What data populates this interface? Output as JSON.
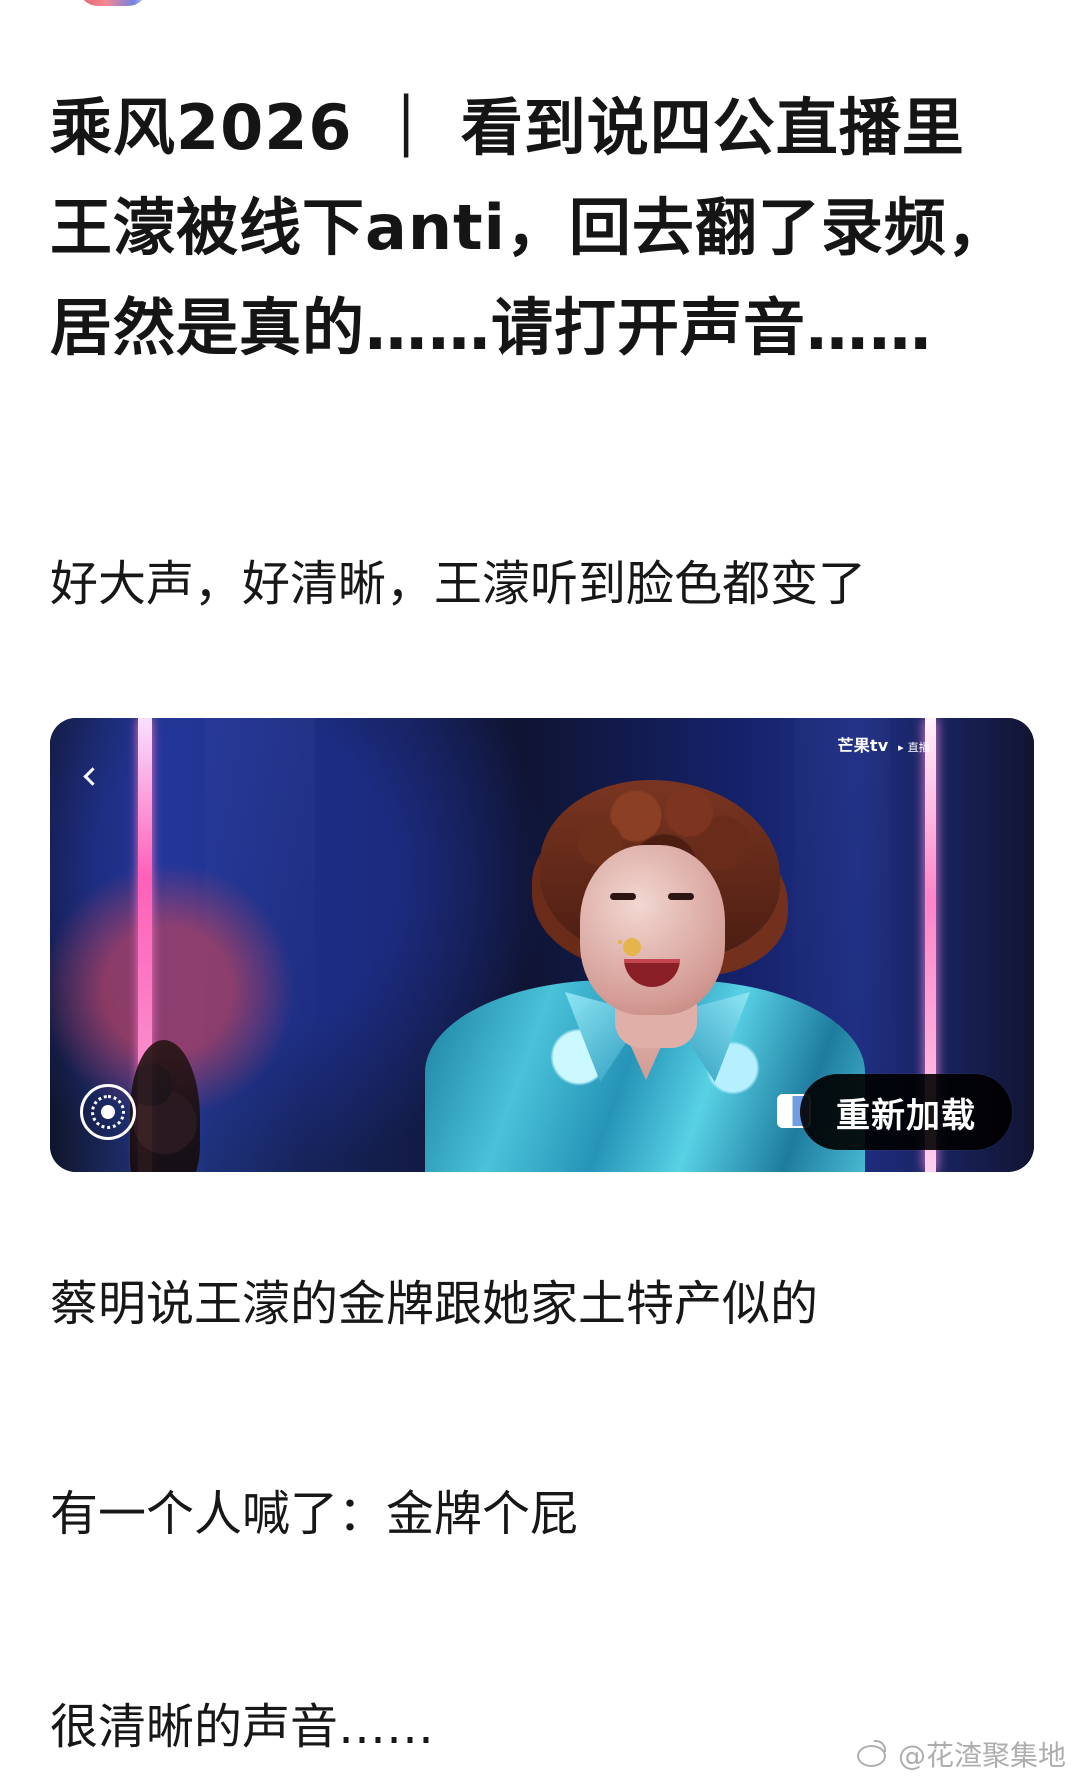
{
  "post": {
    "title": "乘风2026 ｜ 看到说四公直播里王濛被线下anti，回去翻了录频，居然是真的……请打开声音……",
    "paragraphs": [
      "好大声，好清晰，王濛听到脸色都变了",
      "蔡明说王濛的金牌跟她家土特产似的",
      "有一个人喊了：金牌个屁",
      "很清晰的声音……"
    ]
  },
  "video": {
    "brand": "芒果tv",
    "brand_sub": "▸ 直播",
    "reload_label": "重新加载"
  },
  "watermark": {
    "text": "@花渣聚集地"
  },
  "icons": {
    "back": "chevron-left-icon",
    "target": "target-icon",
    "weibo": "weibo-icon"
  },
  "colors": {
    "background": "#ffffff",
    "text": "#111111",
    "reload_button": "#000000",
    "video_pink": "#ff6fbe",
    "video_blue": "#1f2f85"
  }
}
